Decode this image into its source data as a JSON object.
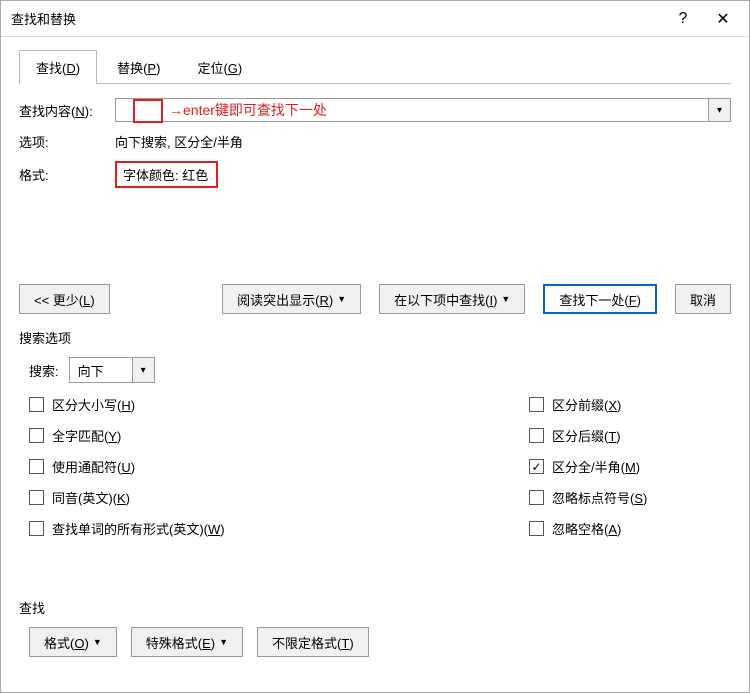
{
  "titlebar": {
    "title": "查找和替换"
  },
  "tabs": {
    "find": "查找(D)",
    "replace": "替换(P)",
    "goto": "定位(G)"
  },
  "find": {
    "label": "查找内容(N):",
    "value": "",
    "annotation": "→enter键即可查找下一处",
    "options_label": "选项:",
    "options_value": "向下搜索, 区分全/半角",
    "format_label": "格式:",
    "format_value": "字体颜色: 红色"
  },
  "buttons": {
    "less": "<< 更少(L)",
    "highlight": "阅读突出显示(R)",
    "find_in": "在以下项中查找(I)",
    "find_next": "查找下一处(F)",
    "cancel": "取消"
  },
  "search_options": {
    "title": "搜索选项",
    "dir_label": "搜索:",
    "dir_value": "向下",
    "match_case": "区分大小写(H)",
    "whole_word": "全字匹配(Y)",
    "wildcards": "使用通配符(U)",
    "sounds_like": "同音(英文)(K)",
    "all_forms": "查找单词的所有形式(英文)(W)",
    "prefix": "区分前缀(X)",
    "suffix": "区分后缀(T)",
    "full_half": "区分全/半角(M)",
    "ignore_punct": "忽略标点符号(S)",
    "ignore_space": "忽略空格(A)"
  },
  "find_section": {
    "label": "查找",
    "format": "格式(O)",
    "special": "特殊格式(E)",
    "no_format": "不限定格式(T)"
  }
}
